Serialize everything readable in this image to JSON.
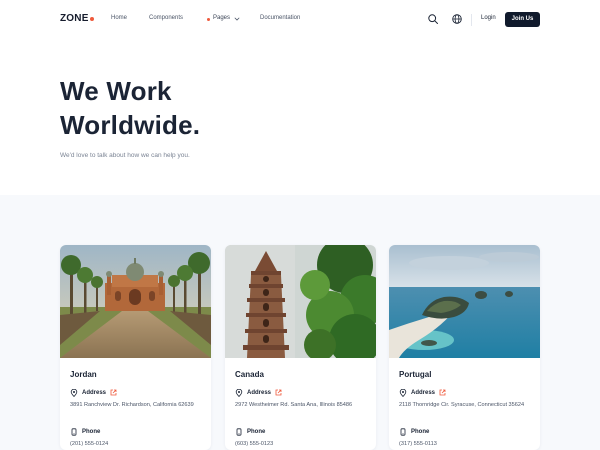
{
  "brand": {
    "name": "ZONE",
    "accent": "#ef5a3c",
    "dark": "#101a2c"
  },
  "nav": {
    "links": [
      "Home",
      "Components",
      "Pages",
      "Documentation"
    ],
    "search_icon": "search-icon",
    "language_icon": "globe-icon",
    "login_label": "Login",
    "join_label": "Join Us"
  },
  "hero": {
    "title_line1": "We Work",
    "title_line2": "Worldwide.",
    "subtitle": "We'd love to talk about how we can help you."
  },
  "offices": [
    {
      "country": "Jordan",
      "address_label": "Address",
      "address": "3891 Ranchview Dr. Richardson, California 62639",
      "phone_label": "Phone",
      "phone": "(201) 555-0124",
      "image": "mosque-with-palm-trees"
    },
    {
      "country": "Canada",
      "address_label": "Address",
      "address": "2972 Westheimer Rd. Santa Ana, Illinois 85486",
      "phone_label": "Phone",
      "phone": "(603) 555-0123",
      "image": "pagoda-with-trees"
    },
    {
      "country": "Portugal",
      "address_label": "Address",
      "address": "2118 Thornridge Cir. Syracuse, Connecticut 35624",
      "phone_label": "Phone",
      "phone": "(317) 555-0113",
      "image": "coastal-islands"
    }
  ]
}
